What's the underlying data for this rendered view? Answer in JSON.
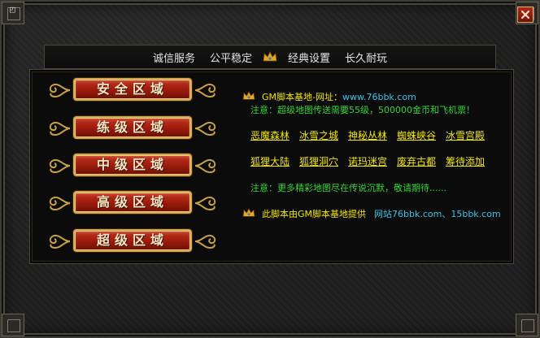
{
  "colors": {
    "accent_yellow": "#f2e600",
    "link_cyan": "#3dc4e8",
    "notice_green": "#35d437",
    "button_red": "#9a1b0c",
    "gold": "#d4a64e"
  },
  "window": {
    "close_icon": "close-icon"
  },
  "tabs": [
    "诚信服务",
    "公平稳定",
    "经典设置",
    "长久耐玩"
  ],
  "zones": [
    "安全区域",
    "练级区域",
    "中级区域",
    "高级区域",
    "超级区域"
  ],
  "info": {
    "site_label": "GM脚本基地-网址：",
    "site_url": "www.76bbk.com",
    "notice1": "注意：超级地图传送需要55级，500000金币和飞机票！",
    "maps_row1": [
      "恶魔森林",
      "冰雪之城",
      "神秘丛林",
      "蜘蛛峡谷",
      "冰雪宫殿"
    ],
    "maps_row2": [
      "狐狸大陆",
      "狐狸洞穴",
      "诺玛迷宫",
      "废弃古都",
      "筹待添加"
    ],
    "notice2": "注意：更多精彩地图尽在传说沉默，敬请期待......",
    "footer_prefix": "此脚本由GM脚本基地提供",
    "footer_sites": "网站76bbk.com、15bbk.com"
  }
}
